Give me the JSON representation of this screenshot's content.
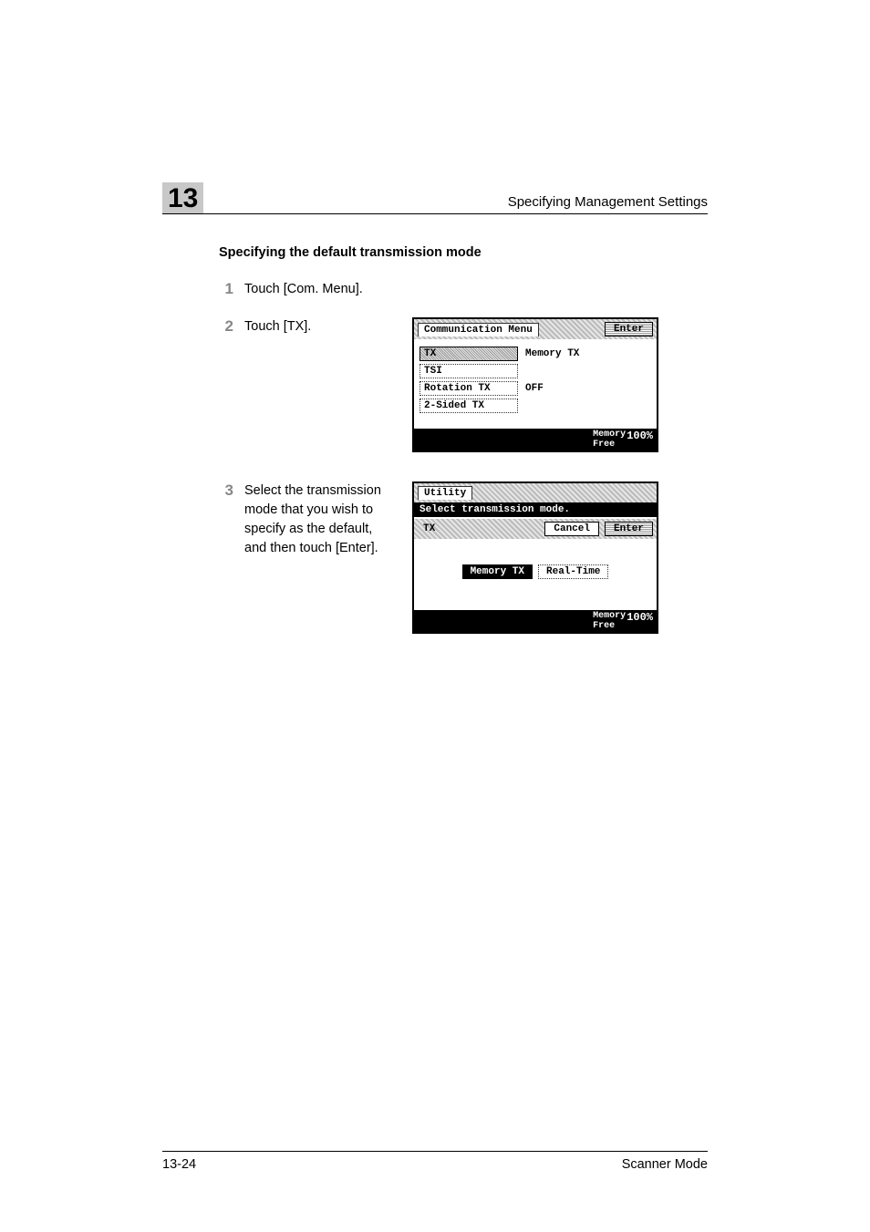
{
  "chapter_number": "13",
  "header_title": "Specifying Management Settings",
  "section_title": "Specifying the default transmission mode",
  "steps": [
    {
      "num": "1",
      "text": "Touch [Com. Menu]."
    },
    {
      "num": "2",
      "text": "Touch [TX]."
    },
    {
      "num": "3",
      "text": "Select the transmission mode that you wish to specify as the default, and then touch [Enter]."
    }
  ],
  "figure1": {
    "header_tab": "Communication Menu",
    "enter_label": "Enter",
    "options": [
      {
        "label": "TX",
        "value": "Memory TX",
        "selected": true
      },
      {
        "label": "TSI",
        "value": ""
      },
      {
        "label": "Rotation TX",
        "value": "OFF"
      },
      {
        "label": "2-Sided TX",
        "value": ""
      }
    ],
    "footer_left": "Memory",
    "footer_left2": "Free",
    "footer_right": "100%"
  },
  "figure2": {
    "header_tab": "Utility",
    "black_bar": "Select transmission mode.",
    "sub_label": "TX",
    "cancel_label": "Cancel",
    "enter_label": "Enter",
    "modes": [
      {
        "label": "Memory TX",
        "selected": true
      },
      {
        "label": "Real-Time",
        "selected": false
      }
    ],
    "footer_left": "Memory",
    "footer_left2": "Free",
    "footer_right": "100%"
  },
  "footer": {
    "page_num": "13-24",
    "mode_label": "Scanner Mode"
  }
}
